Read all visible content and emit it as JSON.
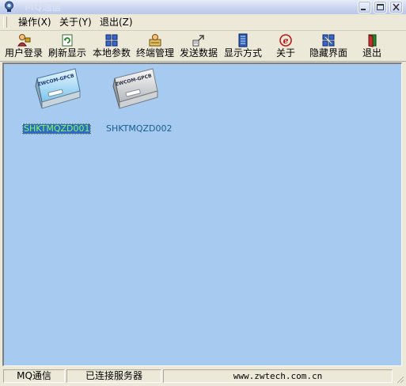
{
  "window": {
    "title": "MQ通信"
  },
  "menu": [
    {
      "label": "操作(X)"
    },
    {
      "label": "关于(Y)"
    },
    {
      "label": "退出(Z)"
    }
  ],
  "toolbar": [
    {
      "label": "用户登录",
      "icon": "user-login-icon"
    },
    {
      "label": "刷新显示",
      "icon": "refresh-icon"
    },
    {
      "label": "本地参数",
      "icon": "local-params-icon"
    },
    {
      "label": "终端管理",
      "icon": "terminal-manage-icon"
    },
    {
      "label": "发送数据",
      "icon": "send-data-icon"
    },
    {
      "label": "显示方式",
      "icon": "display-mode-icon"
    },
    {
      "label": "关于",
      "icon": "about-icon"
    },
    {
      "label": "隐藏界面",
      "icon": "hide-ui-icon"
    },
    {
      "label": "退出",
      "icon": "exit-icon"
    }
  ],
  "devices": [
    {
      "name": "SHKTMQZD001",
      "brand": "ZWCOM-GPCB",
      "selected": true
    },
    {
      "name": "SHKTMQZD002",
      "brand": "ZWCOM-GPCB",
      "selected": false
    }
  ],
  "status": {
    "app": "MQ通信",
    "connection": "已连接服务器",
    "website": "www.zwtech.com.cn"
  },
  "colors": {
    "view_background": "#a6caf0",
    "selection": "#316ac5",
    "selected_text": "#7dff5c",
    "label_text": "#1b5e91"
  }
}
